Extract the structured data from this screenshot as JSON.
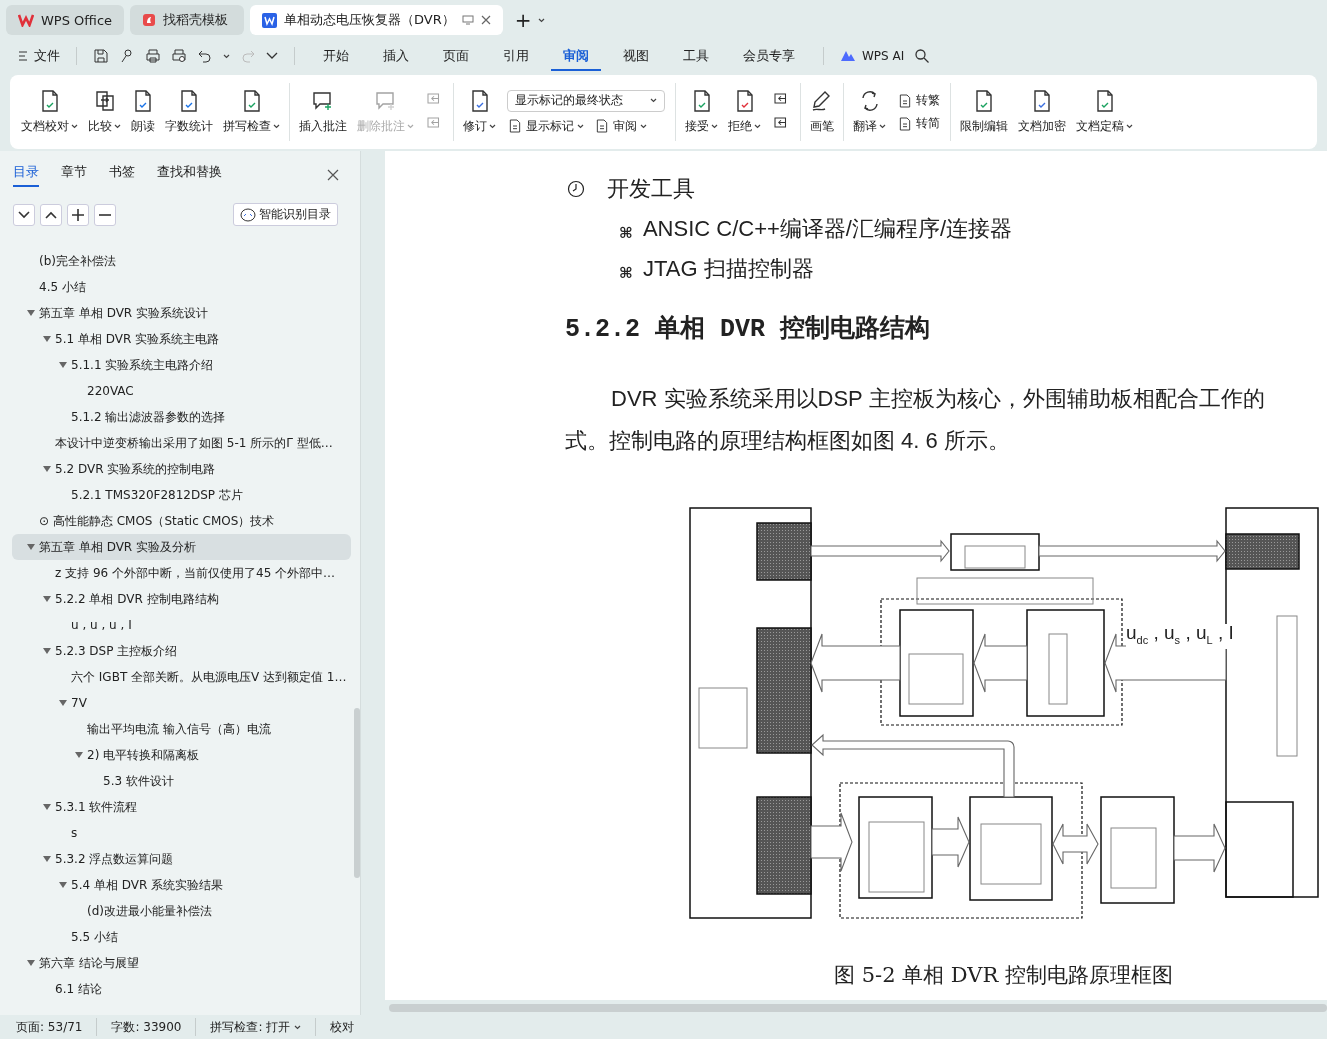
{
  "tabs": [
    {
      "label": "WPS Office",
      "selected": false
    },
    {
      "label": "找稻壳模板",
      "selected": false
    },
    {
      "label": "单相动态电压恢复器（DVR）",
      "selected": true
    }
  ],
  "new_tab": "+",
  "menu": {
    "file": "文件",
    "tabs": [
      {
        "label": "开始",
        "selected": false
      },
      {
        "label": "插入",
        "selected": false
      },
      {
        "label": "页面",
        "selected": false
      },
      {
        "label": "引用",
        "selected": false
      },
      {
        "label": "审阅",
        "selected": true
      },
      {
        "label": "视图",
        "selected": false
      },
      {
        "label": "工具",
        "selected": false
      },
      {
        "label": "会员专享",
        "selected": false
      }
    ],
    "ai": "WPS AI"
  },
  "ribbon": [
    {
      "items": [
        {
          "kind": "large",
          "label": "文档校对",
          "dropdown": true,
          "disabled": false
        },
        {
          "kind": "large",
          "label": "比较",
          "dropdown": true,
          "disabled": false
        },
        {
          "kind": "large",
          "label": "朗读",
          "dropdown": false,
          "disabled": false
        },
        {
          "kind": "large",
          "label": "字数统计",
          "dropdown": false,
          "disabled": false
        },
        {
          "kind": "large",
          "label": "拼写检查",
          "dropdown": true,
          "disabled": false
        }
      ]
    },
    {
      "items": [
        {
          "kind": "large",
          "label": "插入批注",
          "dropdown": false,
          "disabled": false
        },
        {
          "kind": "large",
          "label": "删除批注",
          "dropdown": true,
          "disabled": true
        },
        {
          "kind": "stack",
          "rows": [
            [
              {
                "kind": "icon",
                "disabled": true
              }
            ],
            [
              {
                "kind": "icon",
                "disabled": true
              }
            ]
          ]
        }
      ]
    },
    {
      "items": [
        {
          "kind": "large",
          "label": "修订",
          "dropdown": true,
          "disabled": false
        },
        {
          "kind": "stack",
          "rows": [
            [
              {
                "kind": "select",
                "value": "显示标记的最终状态"
              }
            ],
            [
              {
                "kind": "small",
                "label": "显示标记",
                "dropdown": true,
                "disabled": false
              },
              {
                "kind": "small",
                "label": "审阅",
                "dropdown": true,
                "disabled": false
              }
            ]
          ]
        }
      ]
    },
    {
      "items": [
        {
          "kind": "large",
          "label": "接受",
          "dropdown": true,
          "disabled": false
        },
        {
          "kind": "large",
          "label": "拒绝",
          "dropdown": true,
          "disabled": false
        },
        {
          "kind": "stack",
          "rows": [
            [
              {
                "kind": "icon",
                "disabled": false
              }
            ],
            [
              {
                "kind": "icon",
                "disabled": false
              }
            ]
          ]
        }
      ]
    },
    {
      "items": [
        {
          "kind": "large",
          "label": "画笔",
          "dropdown": false,
          "disabled": false
        }
      ]
    },
    {
      "items": [
        {
          "kind": "large",
          "label": "翻译",
          "dropdown": true,
          "disabled": false
        },
        {
          "kind": "stack",
          "rows": [
            [
              {
                "kind": "small",
                "label": "转繁",
                "dropdown": false,
                "disabled": false
              }
            ],
            [
              {
                "kind": "small",
                "label": "转简",
                "dropdown": false,
                "disabled": false
              }
            ]
          ]
        }
      ]
    },
    {
      "items": [
        {
          "kind": "large",
          "label": "限制编辑",
          "dropdown": false,
          "disabled": false
        },
        {
          "kind": "large",
          "label": "文档加密",
          "dropdown": false,
          "disabled": false
        },
        {
          "kind": "large",
          "label": "文档定稿",
          "dropdown": true,
          "disabled": false
        }
      ]
    }
  ],
  "nav_panel": {
    "tabs": [
      {
        "label": "目录",
        "selected": true
      },
      {
        "label": "章节",
        "selected": false
      },
      {
        "label": "书签",
        "selected": false
      },
      {
        "label": "查找和替换",
        "selected": false
      }
    ],
    "smart_button": "智能识别目录",
    "toc": [
      {
        "children": [
          {
            "children": [
              {
                "text": "(b)完全补偿法",
                "selected": false
              }
            ]
          },
          {
            "text": "4.5 小结",
            "selected": false
          }
        ]
      },
      {
        "text": "第五章  单相 DVR 实验系统设计",
        "selected": false,
        "expanded": true,
        "children": [
          {
            "text": "5.1 单相 DVR 实验系统主电路",
            "selected": false,
            "expanded": true,
            "children": [
              {
                "text": "5.1.1 实验系统主电路介绍",
                "selected": false,
                "expanded": true,
                "children": [
                  {
                    "text": "220VAC",
                    "selected": false
                  }
                ]
              },
              {
                "text": "5.1.2 输出滤波器参数的选择",
                "selected": false
              }
            ]
          },
          {
            "text": "本设计中逆变桥输出采用了如图 5-1 所示的Γ 型低…",
            "selected": false
          },
          {
            "text": "5.2 DVR 实验系统的控制电路",
            "selected": false,
            "expanded": true,
            "children": [
              {
                "text": "5.2.1 TMS320F2812DSP 芯片",
                "selected": false
              }
            ]
          }
        ]
      },
      {
        "text": "⊙ 高性能静态 CMOS（Static CMOS）技术",
        "selected": false
      },
      {
        "text": "第五章  单相 DVR 实验及分析",
        "selected": true,
        "expanded": true,
        "children": [
          {
            "text": "z 支持 96 个外部中断，当前仅使用了45 个外部中…",
            "selected": false
          },
          {
            "text": "5.2.2 单相 DVR 控制电路结构",
            "selected": false,
            "expanded": true,
            "children": [
              {
                "text": "u , u , u , I",
                "selected": false
              }
            ]
          },
          {
            "text": "5.2.3 DSP 主控板介绍",
            "selected": false,
            "expanded": true,
            "children": [
              {
                "text": "六个 IGBT 全部关断。从电源电压V 达到额定值 1…",
                "selected": false
              },
              {
                "text": "7V",
                "selected": false,
                "expanded": true,
                "children": [
                  {
                    "text": "输出平均电流   输入信号（高）电流",
                    "selected": false
                  },
                  {
                    "text": "2) 电平转换和隔离板",
                    "selected": false,
                    "expanded": true,
                    "children": [
                      {
                        "text": "5.3 软件设计",
                        "selected": false
                      }
                    ]
                  }
                ]
              }
            ]
          },
          {
            "text": "5.3.1 软件流程",
            "selected": false,
            "expanded": true,
            "children": [
              {
                "text": "s",
                "selected": false
              }
            ]
          },
          {
            "text": "5.3.2 浮点数运算问题",
            "selected": false,
            "expanded": true,
            "children": [
              {
                "text": "5.4 单相 DVR 系统实验结果",
                "selected": false,
                "expanded": true,
                "children": [
                  {
                    "text": "(d)改进最小能量补偿法",
                    "selected": false
                  }
                ]
              },
              {
                "text": "5.5 小结",
                "selected": false
              }
            ]
          }
        ]
      },
      {
        "text": "第六章  结论与展望",
        "selected": false,
        "expanded": true,
        "children": [
          {
            "text": "6.1 结论",
            "selected": false
          }
        ]
      }
    ]
  },
  "document": {
    "list": [
      {
        "kind": "clock",
        "text": "开发工具"
      },
      {
        "kind": "glyph",
        "bullet": "⌘",
        "text": "ANSIC C/C++编译器/汇编程序/连接器"
      },
      {
        "kind": "glyph",
        "bullet": "⌘",
        "text": "JTAG 扫描控制器"
      }
    ],
    "heading": "5.2.2 单相 DVR 控制电路结构",
    "paragraph_lines": [
      "DVR 实验系统采用以DSP 主控板为核心，外围辅助板相配合工作的",
      "式。控制电路的原理结构框图如图 4. 6 所示。"
    ],
    "figure": {
      "signal_label": "u$_{dc}$ , u$_{s}$ , u$_{L}$ , I",
      "caption": "图 5-2 单相 DVR 控制电路原理框图"
    }
  },
  "status_bar": [
    {
      "text": "页面: 53/71",
      "dropdown": false
    },
    {
      "text": "字数: 33900",
      "dropdown": false
    },
    {
      "text": "拼写检查: 打开",
      "dropdown": true
    },
    {
      "text": "校对",
      "dropdown": false
    }
  ]
}
